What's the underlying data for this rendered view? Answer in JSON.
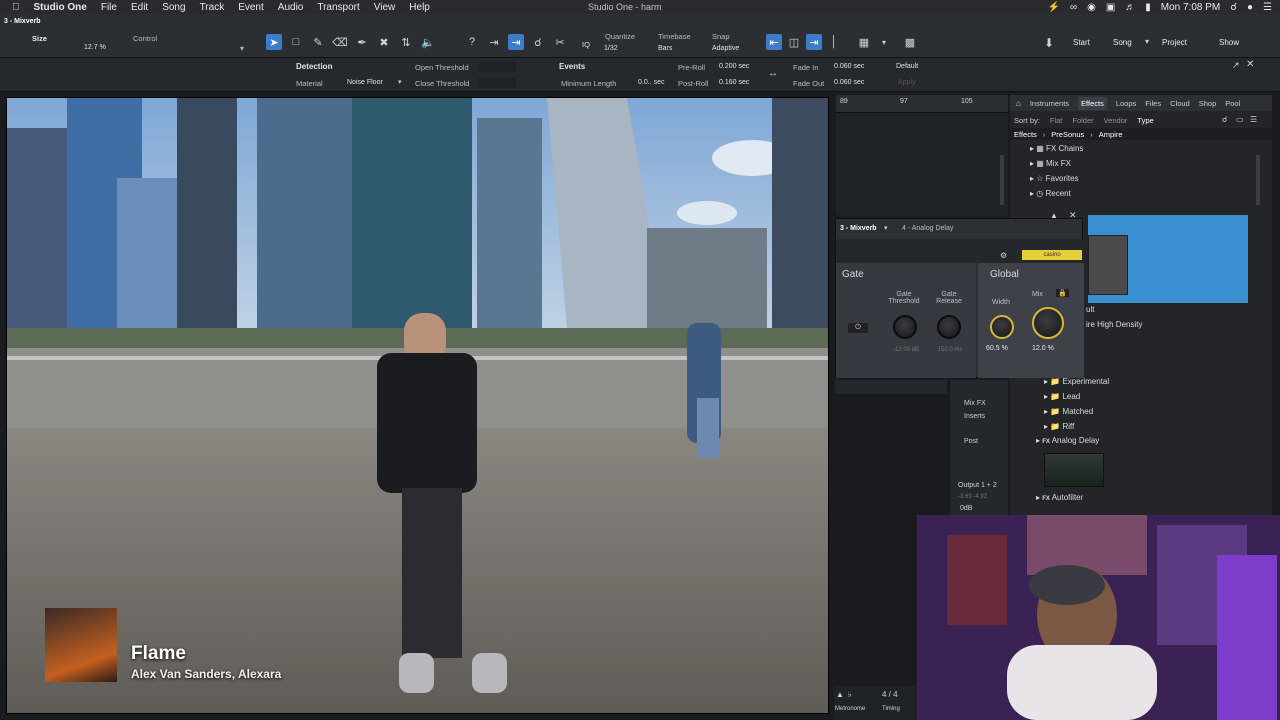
{
  "menubar": {
    "items": [
      "Studio One",
      "File",
      "Edit",
      "Song",
      "Track",
      "Event",
      "Audio",
      "Transport",
      "View",
      "Help"
    ],
    "window_title": "Studio One - harm",
    "clock": "Mon 7:08 PM"
  },
  "toolbar": {
    "track_name": "3 - Mixverb",
    "size_label": "Size",
    "size_value": "12.7 %",
    "control_label": "Control",
    "quantize_label": "Quantize",
    "quantize_value": "1/32",
    "timebase_label": "Timebase",
    "timebase_value": "Bars",
    "snap_label": "Snap",
    "snap_value": "Adaptive",
    "iq_label": "IQ",
    "nav": {
      "start": "Start",
      "song": "Song",
      "project": "Project",
      "show": "Show"
    }
  },
  "inspector": {
    "detection": "Detection",
    "material_label": "Material",
    "material_value": "Noise Floor",
    "open_threshold": "Open Threshold",
    "close_threshold": "Close Threshold",
    "events": "Events",
    "minimum_length": "Minimum Length",
    "minimum_length_value": "0.0.. sec",
    "pre_roll": "Pre-Roll",
    "pre_roll_value": "0.200 sec",
    "post_roll": "Post-Roll",
    "post_roll_value": "0.160 sec",
    "fade_in": "Fade In",
    "fade_in_value": "0.060 sec",
    "fade_out": "Fade Out",
    "fade_out_value": "0.060 sec",
    "default": "Default",
    "apply": "Apply"
  },
  "video": {
    "song_title": "Flame",
    "artists": "Alex Van Sanders, Alexara"
  },
  "arrange": {
    "ruler": [
      "89",
      "97",
      "105"
    ]
  },
  "browser": {
    "tabs": [
      "Instruments",
      "Effects",
      "Loops",
      "Files",
      "Cloud",
      "Shop",
      "Pool"
    ],
    "active_tab": "Effects",
    "sort_by": "Sort by:",
    "sort_options": [
      "Flat",
      "Folder",
      "Vendor",
      "Type"
    ],
    "breadcrumb": [
      "Effects",
      "PreSonus",
      "Ampire"
    ],
    "tree_top": [
      "FX Chains",
      "Mix FX",
      "Favorites",
      "Recent"
    ],
    "partial_items": [
      "ult",
      "ire High Density"
    ],
    "folders": [
      "Experimental",
      "Lead",
      "Matched",
      "Riff"
    ],
    "analog_delay": "Analog Delay",
    "autofilter": "Autofilter"
  },
  "plugin": {
    "channel": "3 - Mixverb",
    "plugin_name": "4 - Analog Delay",
    "preset": "casino",
    "gate": {
      "title": "Gate",
      "threshold_label": "Gate Threshold",
      "threshold_value": "-12.00 dB",
      "release_label": "Gate Release",
      "release_value": "150.0 ms"
    },
    "global": {
      "title": "Global",
      "width_label": "Width",
      "width_value": "60.5 %",
      "mix_label": "Mix",
      "mix_value": "12.0 %"
    }
  },
  "mixer": {
    "mix_fx": "Mix FX",
    "inserts": "Inserts",
    "post": "Post",
    "output": "Output 1 + 2",
    "levels": "-3.69  -4.92",
    "odb": "0dB",
    "counter": "4 / 4",
    "metronome": "Metronome",
    "timing": "Timing"
  },
  "colors": {
    "accent_blue": "#3d7cc9",
    "preset_yellow": "#e6cf3a",
    "knob_ring": "#d9b53a"
  }
}
